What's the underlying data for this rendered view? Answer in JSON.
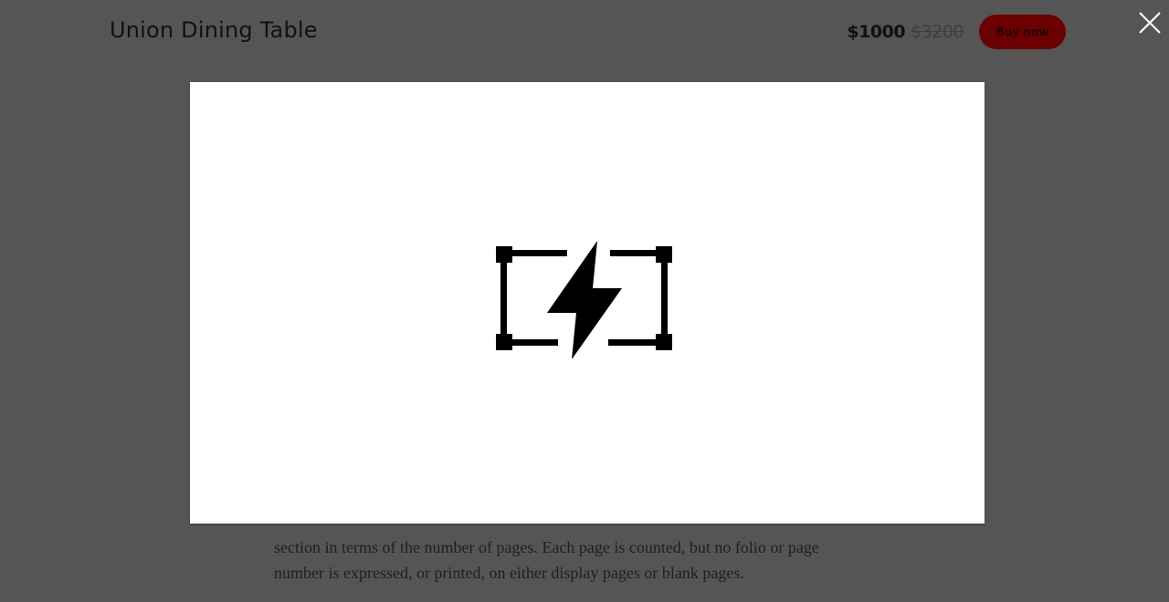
{
  "header": {
    "product_title": "Union Dining Table",
    "price_current": "$1000",
    "price_original": "$3200",
    "buy_label": "Buy now",
    "close_icon": "close-icon"
  },
  "modal": {
    "icon": "lightning-bolt-frame-icon"
  },
  "background": {
    "line_1": "section in terms of the number of pages. Each page is counted, but no folio or page",
    "line_2": "number is expressed, or printed, on either display pages or blank pages."
  },
  "colors": {
    "overlay": "#555555",
    "modal_bg": "#ffffff",
    "buy_button": "#6b0000",
    "icon": "#000000"
  }
}
